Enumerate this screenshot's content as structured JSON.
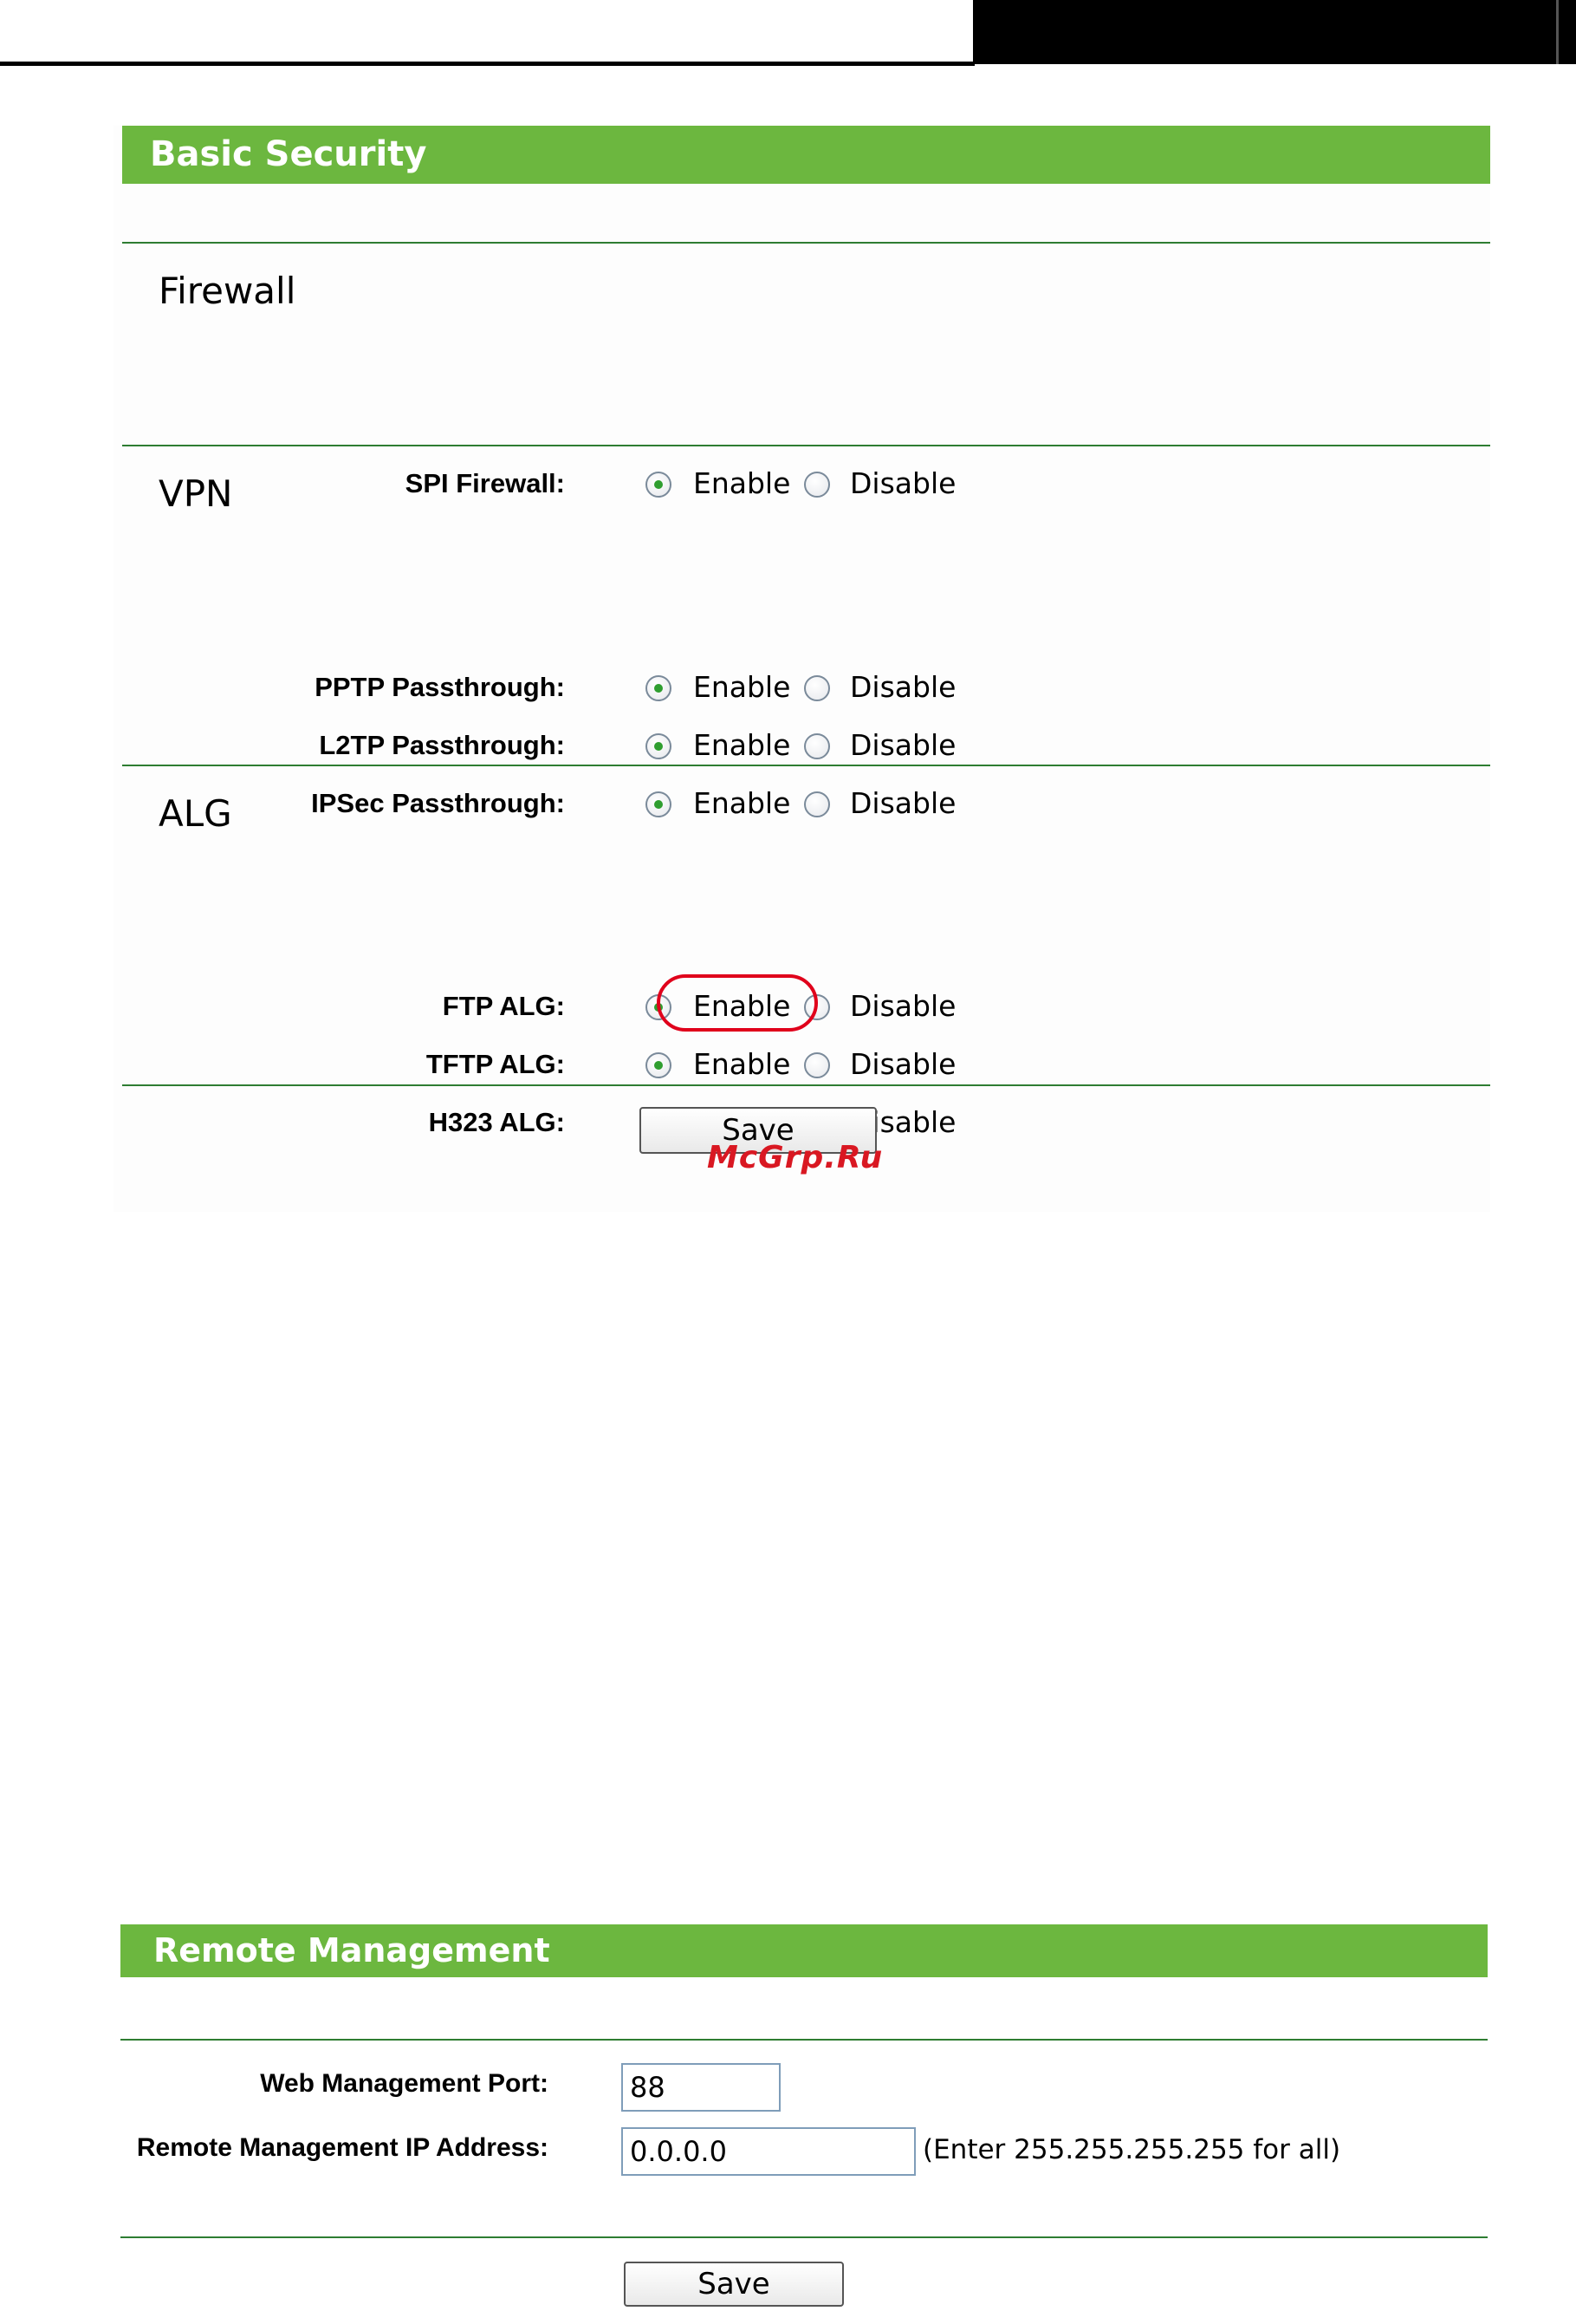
{
  "basic_security": {
    "title": "Basic Security",
    "enable_label": "Enable",
    "disable_label": "Disable",
    "save_label": "Save",
    "sections": {
      "firewall": {
        "title": "Firewall",
        "rows": [
          {
            "label": "SPI Firewall:",
            "selected": "Enable"
          }
        ]
      },
      "vpn": {
        "title": "VPN",
        "rows": [
          {
            "label": "PPTP Passthrough:",
            "selected": "Enable"
          },
          {
            "label": "L2TP Passthrough:",
            "selected": "Enable"
          },
          {
            "label": "IPSec Passthrough:",
            "selected": "Enable"
          }
        ]
      },
      "alg": {
        "title": "ALG",
        "rows": [
          {
            "label": "FTP ALG:",
            "selected": "Enable"
          },
          {
            "label": "TFTP ALG:",
            "selected": "Enable"
          },
          {
            "label": "H323 ALG:",
            "selected": "Enable"
          }
        ]
      }
    }
  },
  "watermark": "McGrp.Ru",
  "remote_management": {
    "title": "Remote Management",
    "web_port_label": "Web Management Port:",
    "web_port_value": "88",
    "ip_label": "Remote Management IP Address:",
    "ip_value": "0.0.0.0",
    "ip_hint": "(Enter 255.255.255.255 for all)",
    "save_label": "Save"
  },
  "colors": {
    "header_green": "#6cb73f",
    "divider_green": "#2e7d32",
    "radio_dot": "#2f9e2f",
    "highlight_red": "#e0001b"
  }
}
